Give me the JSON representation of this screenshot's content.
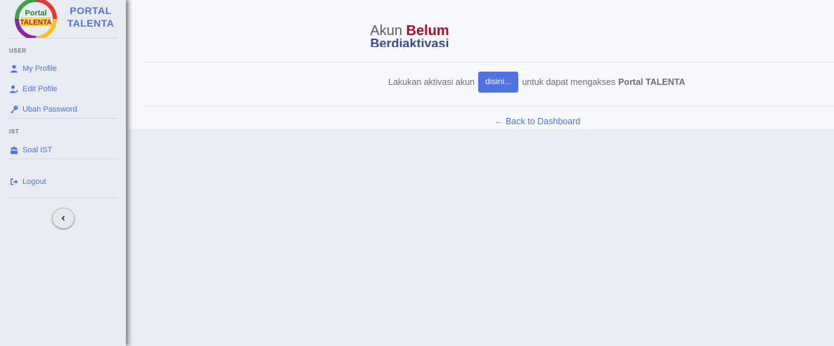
{
  "brand": {
    "name_line1": "PORTAL",
    "name_line2": "TALENTA",
    "logo_line1": "Portal",
    "logo_line2": "TALENTA"
  },
  "sidebar": {
    "heading_user": "USER",
    "items_user": [
      {
        "label": "My Profile",
        "icon": "user-icon"
      },
      {
        "label": "Edit Pofile",
        "icon": "user-edit-icon"
      },
      {
        "label": "Ubah Password",
        "icon": "key-icon"
      }
    ],
    "heading_ist": "IST",
    "items_ist": [
      {
        "label": "Soal IST",
        "icon": "users-icon"
      }
    ],
    "logout": {
      "label": "Logout",
      "icon": "logout-icon"
    }
  },
  "main": {
    "title_prefix": "Akun",
    "title_accent": "Belum",
    "title_second": "Berdiaktivasi",
    "message_before": "Lakukan aktivasi akun",
    "activate_button": "disini...",
    "message_after": "untuk dapat mengakses",
    "message_strong": "Portal TALENTA",
    "back_link": "← Back to Dashboard"
  },
  "colors": {
    "accent": "#4e73df",
    "danger": "#a50d2f",
    "sidebar_bg": "#e8ebf2"
  }
}
